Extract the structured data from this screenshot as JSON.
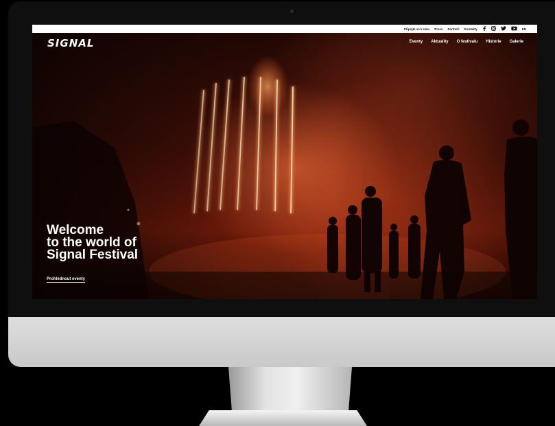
{
  "site": {
    "logo_text": "SIGNAL"
  },
  "utility_bar": {
    "links": [
      "Připojte se k nám",
      "Press",
      "Partneři",
      "Kontakty"
    ],
    "language": "EN",
    "icons": [
      "facebook-icon",
      "instagram-icon",
      "twitter-icon",
      "youtube-icon"
    ]
  },
  "nav": {
    "items": [
      "Eventy",
      "Aktuality",
      "O festivalu",
      "Historie",
      "Galerie"
    ]
  },
  "hero": {
    "title_lines": [
      "Welcome",
      "to the world of",
      "Signal Festival"
    ],
    "cta_label": "Prohlédnout eventy"
  },
  "colors": {
    "accent_glow": "#e8673a",
    "light_bars": "#ffd9a8",
    "utility_bg": "#ffffff"
  }
}
